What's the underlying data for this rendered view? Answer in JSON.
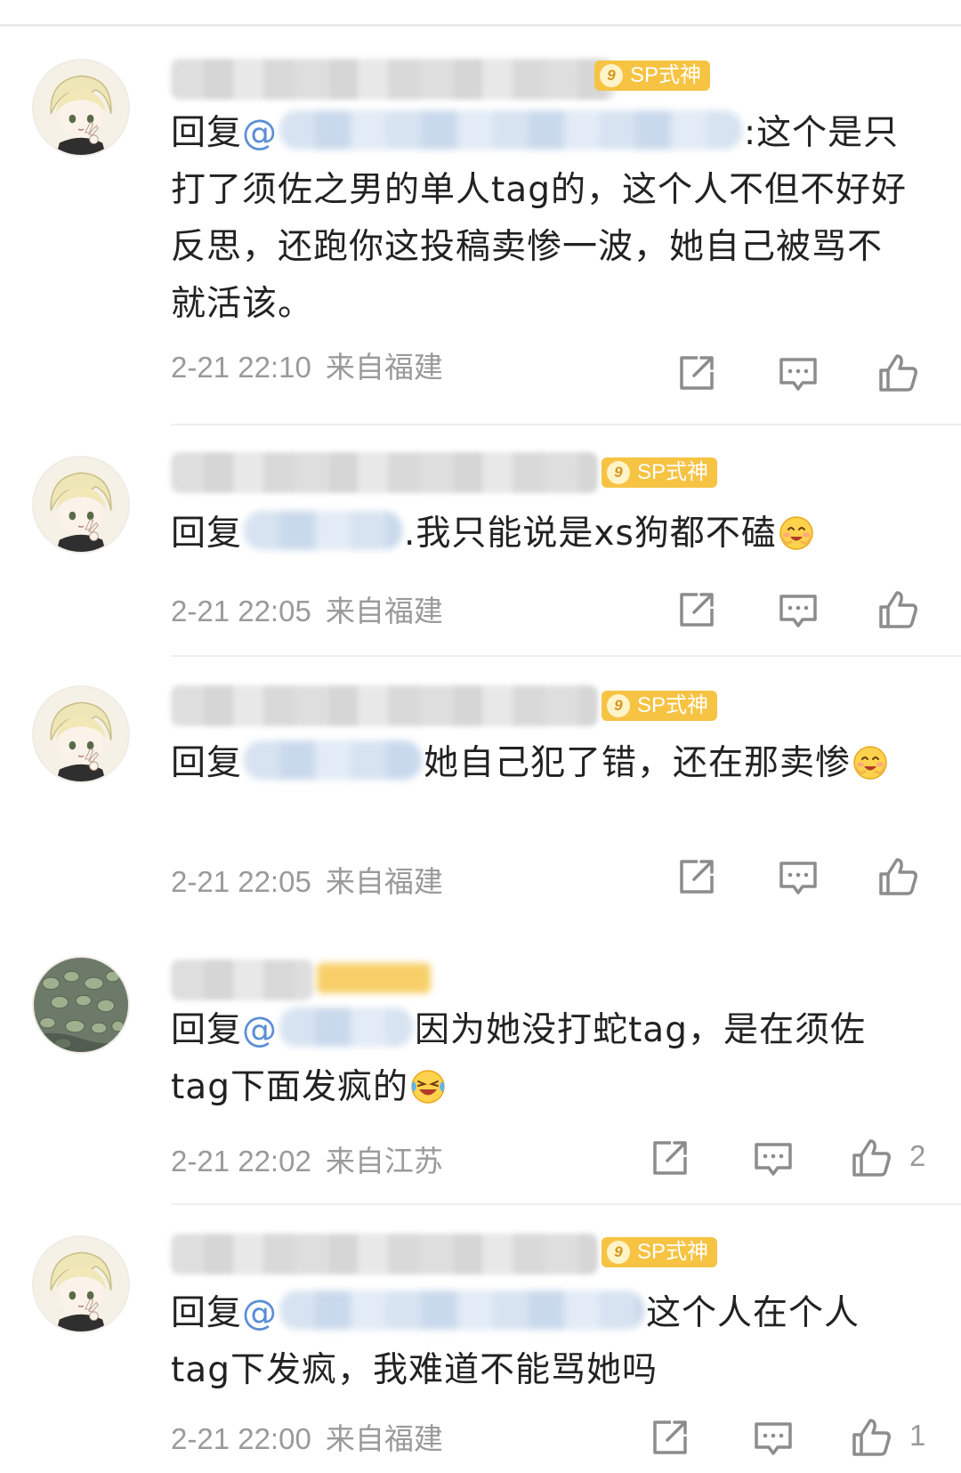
{
  "comments": [
    {
      "badge": "SP式神",
      "prefix": "回复",
      "mention_start": "@",
      "mention_tail": "",
      "body": ":这个是只打了须佐之男的单人tag的，这个人不但不好好反思，还跑你这投稿卖惨一波，她自己被骂不就活该。",
      "time": "2-21 22:10",
      "location": "来自福建",
      "likes": ""
    },
    {
      "badge": "SP式神",
      "prefix": "回复",
      "mention_start": "",
      "mention_tail": "",
      "body": ".我只能说是xs狗都不磕",
      "time": "2-21 22:05",
      "location": "来自福建",
      "likes": ""
    },
    {
      "badge": "SP式神",
      "prefix": "回复",
      "mention_start": "",
      "mention_tail": "",
      "body": "她自己犯了错，还在那卖惨",
      "time": "2-21 22:05",
      "location": "来自福建",
      "likes": ""
    },
    {
      "badge": "",
      "prefix": "回复",
      "mention_start": "@",
      "mention_tail": "",
      "body": "因为她没打蛇tag，是在须佐tag下面发疯的",
      "time": "2-21 22:02",
      "location": "来自江苏",
      "likes": "2"
    },
    {
      "badge": "SP式神",
      "prefix": "回复",
      "mention_start": "@",
      "mention_tail": "",
      "body": "这个人在个人tag下发疯，我难道不能骂她吗",
      "time": "2-21 22:00",
      "location": "来自福建",
      "likes": "1"
    }
  ],
  "icons": {
    "share": "share-icon",
    "comment": "comment-icon",
    "like": "thumbs-up-icon"
  },
  "colors": {
    "badge": "#f6c343",
    "mention": "#5b8ed6",
    "meta": "#9a9a9a"
  }
}
